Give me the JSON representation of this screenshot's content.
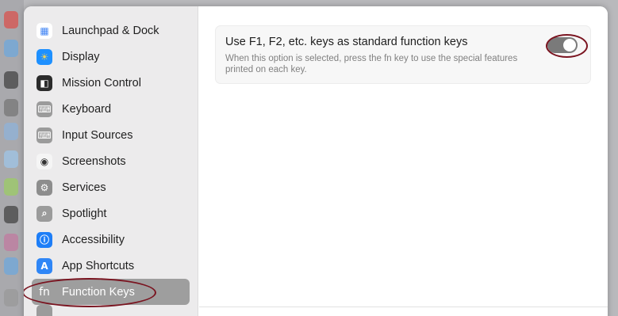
{
  "sidebar": {
    "items": [
      {
        "label": "Launchpad & Dock",
        "icon": "launchpad-icon",
        "color": "#ffffff"
      },
      {
        "label": "Display",
        "icon": "sun-icon",
        "color": "#1e90ff"
      },
      {
        "label": "Mission Control",
        "icon": "mission-control-icon",
        "color": "#2b2b2b"
      },
      {
        "label": "Keyboard",
        "icon": "keyboard-icon",
        "color": "#9b9b9b"
      },
      {
        "label": "Input Sources",
        "icon": "keyboard-icon",
        "color": "#9b9b9b"
      },
      {
        "label": "Screenshots",
        "icon": "screenshot-icon",
        "color": "#f5f5f5"
      },
      {
        "label": "Services",
        "icon": "gears-icon",
        "color": "#8d8d8d"
      },
      {
        "label": "Spotlight",
        "icon": "magnifier-icon",
        "color": "#9b9b9b"
      },
      {
        "label": "Accessibility",
        "icon": "accessibility-icon",
        "color": "#1e7ef7"
      },
      {
        "label": "App Shortcuts",
        "icon": "app-store-icon",
        "color": "#2f86f6"
      },
      {
        "label": "Function Keys",
        "icon": "fn-icon",
        "color": "#9e9e9e",
        "selected": true
      }
    ],
    "glyphs": {
      "launchpad": "▦",
      "display": "☀",
      "mission": "◧",
      "keyboard": "⌨",
      "input": "⌨",
      "screenshots": "◉",
      "services": "⚙",
      "spotlight": "⌕",
      "accessibility": "ⓘ",
      "shortcuts": "A",
      "fn": "fn"
    }
  },
  "main": {
    "option_title": "Use F1, F2, etc. keys as standard function keys",
    "option_desc": "When this option is selected, press the fn key to use the special features printed on each key.",
    "toggle_on": false
  },
  "colors": {
    "annotation": "#7a1420",
    "selected_bg": "#9e9e9e"
  }
}
